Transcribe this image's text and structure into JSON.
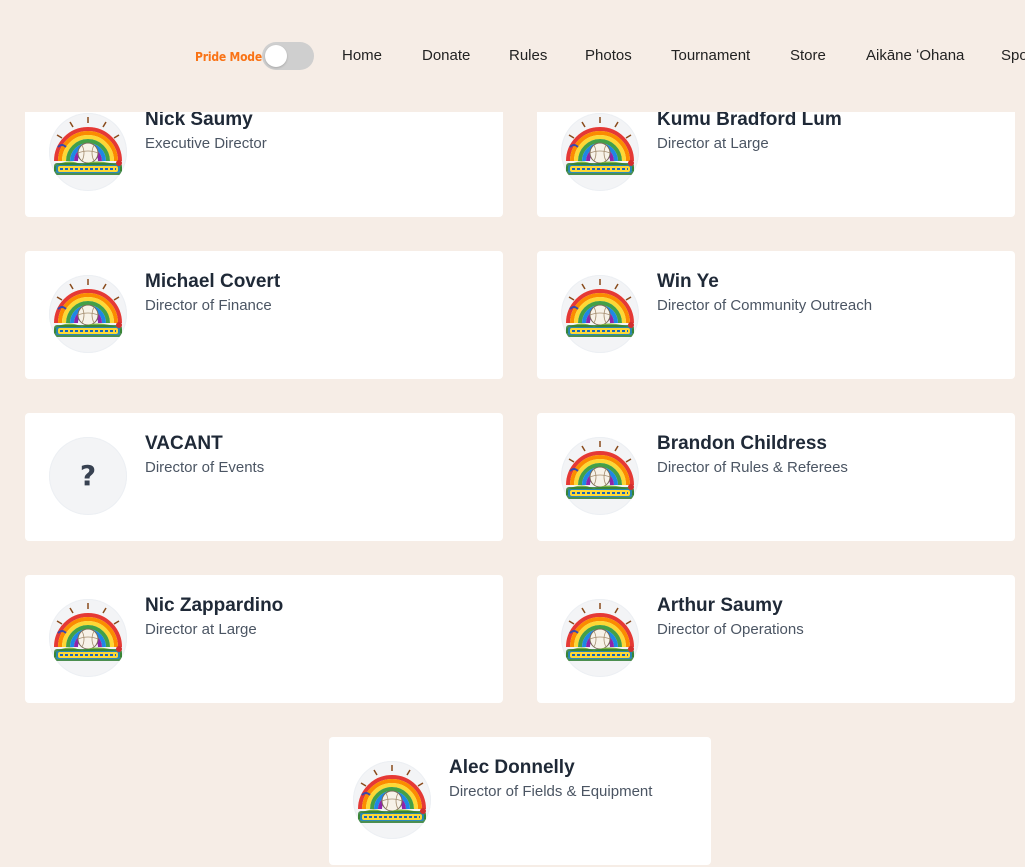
{
  "header": {
    "pride_mode_label": "Pride Mode",
    "nav": [
      "Home",
      "Donate",
      "Rules",
      "Photos",
      "Tournament",
      "Store",
      "Aikāne ʻOhana",
      "Spo"
    ]
  },
  "board": [
    {
      "name": "Nick Saumy",
      "role": "Executive Director",
      "avatar": "logo"
    },
    {
      "name": "Kumu Bradford Lum",
      "role": "Director at Large",
      "avatar": "logo"
    },
    {
      "name": "Michael Covert",
      "role": "Director of Finance",
      "avatar": "logo"
    },
    {
      "name": "Win Ye",
      "role": "Director of Community Outreach",
      "avatar": "logo"
    },
    {
      "name": "VACANT",
      "role": "Director of Events",
      "avatar": "?"
    },
    {
      "name": "Brandon Childress",
      "role": "Director of Rules & Referees",
      "avatar": "logo"
    },
    {
      "name": "Nic Zappardino",
      "role": "Director at Large",
      "avatar": "logo"
    },
    {
      "name": "Arthur Saumy",
      "role": "Director of Operations",
      "avatar": "logo"
    },
    {
      "name": "Alec Donnelly",
      "role": "Director of Fields & Equipment",
      "avatar": "logo"
    }
  ],
  "colors": {
    "background": "#f6ede6",
    "card": "#ffffff",
    "pride_label": "#f97316"
  }
}
